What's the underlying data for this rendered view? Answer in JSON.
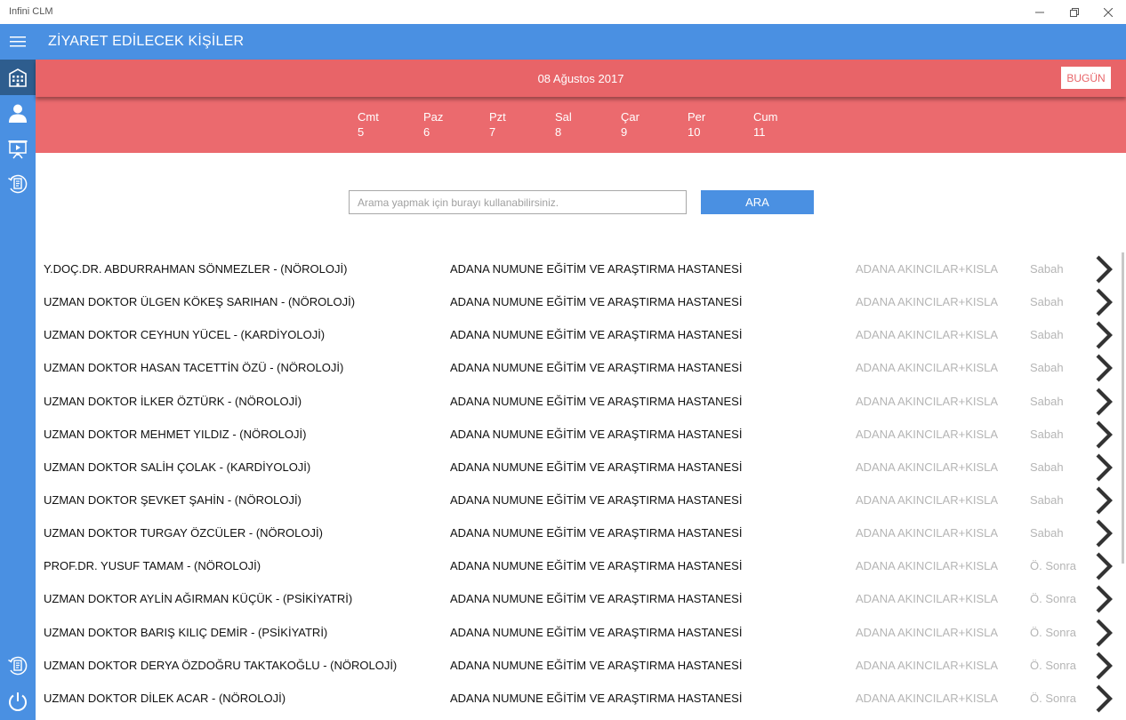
{
  "window": {
    "title": "Infini CLM"
  },
  "header": {
    "title": "ZİYARET EDİLECEK KİŞİLER"
  },
  "date_bar": {
    "current_date": "08 Ağustos 2017",
    "today_label": "BUGÜN",
    "days": [
      {
        "name": "Cmt",
        "num": "5"
      },
      {
        "name": "Paz",
        "num": "6"
      },
      {
        "name": "Pzt",
        "num": "7"
      },
      {
        "name": "Sal",
        "num": "8"
      },
      {
        "name": "Çar",
        "num": "9"
      },
      {
        "name": "Per",
        "num": "10"
      },
      {
        "name": "Cum",
        "num": "11"
      }
    ]
  },
  "search": {
    "placeholder": "Arama yapmak için burayı kullanabilirsiniz.",
    "value": "",
    "button_label": "ARA"
  },
  "icons": {
    "sidebar": [
      "menu-icon",
      "building-icon",
      "user-icon",
      "presentation-icon",
      "visits-icon",
      "reports-icon",
      "power-icon"
    ],
    "row": "chevron-right-icon"
  },
  "colors": {
    "accent": "#4a90e2",
    "sidebar_active": "#2e5d8e",
    "date_band": "#eb6a6e",
    "muted_text": "#b5b5b5"
  },
  "visits": [
    {
      "name": "Y.DOÇ.DR. ABDURRAHMAN SÖNMEZLER - (NÖROLOJİ)",
      "hospital": "ADANA NUMUNE EĞİTİM VE ARAŞTIRMA HASTANESİ",
      "area": "ADANA AKINCILAR+KISLA",
      "time": "Sabah"
    },
    {
      "name": "UZMAN DOKTOR ÜLGEN KÖKEŞ SARIHAN - (NÖROLOJİ)",
      "hospital": "ADANA NUMUNE EĞİTİM VE ARAŞTIRMA HASTANESİ",
      "area": "ADANA AKINCILAR+KISLA",
      "time": "Sabah"
    },
    {
      "name": "UZMAN DOKTOR CEYHUN YÜCEL - (KARDİYOLOJİ)",
      "hospital": "ADANA NUMUNE EĞİTİM VE ARAŞTIRMA HASTANESİ",
      "area": "ADANA AKINCILAR+KISLA",
      "time": "Sabah"
    },
    {
      "name": "UZMAN DOKTOR HASAN TACETTİN ÖZÜ - (NÖROLOJİ)",
      "hospital": "ADANA NUMUNE EĞİTİM VE ARAŞTIRMA HASTANESİ",
      "area": "ADANA AKINCILAR+KISLA",
      "time": "Sabah"
    },
    {
      "name": "UZMAN DOKTOR İLKER ÖZTÜRK - (NÖROLOJİ)",
      "hospital": "ADANA NUMUNE EĞİTİM VE ARAŞTIRMA HASTANESİ",
      "area": "ADANA AKINCILAR+KISLA",
      "time": "Sabah"
    },
    {
      "name": "UZMAN DOKTOR MEHMET YILDIZ - (NÖROLOJİ)",
      "hospital": "ADANA NUMUNE EĞİTİM VE ARAŞTIRMA HASTANESİ",
      "area": "ADANA AKINCILAR+KISLA",
      "time": "Sabah"
    },
    {
      "name": "UZMAN DOKTOR SALİH ÇOLAK - (KARDİYOLOJİ)",
      "hospital": "ADANA NUMUNE EĞİTİM VE ARAŞTIRMA HASTANESİ",
      "area": "ADANA AKINCILAR+KISLA",
      "time": "Sabah"
    },
    {
      "name": "UZMAN DOKTOR ŞEVKET ŞAHİN - (NÖROLOJİ)",
      "hospital": "ADANA NUMUNE EĞİTİM VE ARAŞTIRMA HASTANESİ",
      "area": "ADANA AKINCILAR+KISLA",
      "time": "Sabah"
    },
    {
      "name": "UZMAN DOKTOR TURGAY ÖZCÜLER - (NÖROLOJİ)",
      "hospital": "ADANA NUMUNE EĞİTİM VE ARAŞTIRMA HASTANESİ",
      "area": "ADANA AKINCILAR+KISLA",
      "time": "Sabah"
    },
    {
      "name": "PROF.DR. YUSUF TAMAM - (NÖROLOJİ)",
      "hospital": "ADANA NUMUNE EĞİTİM VE ARAŞTIRMA HASTANESİ",
      "area": "ADANA AKINCILAR+KISLA",
      "time": "Ö. Sonra"
    },
    {
      "name": "UZMAN DOKTOR AYLİN AĞIRMAN KÜÇÜK - (PSİKİYATRİ)",
      "hospital": "ADANA NUMUNE EĞİTİM VE ARAŞTIRMA HASTANESİ",
      "area": "ADANA AKINCILAR+KISLA",
      "time": "Ö. Sonra"
    },
    {
      "name": "UZMAN DOKTOR BARIŞ KILIÇ DEMİR - (PSİKİYATRİ)",
      "hospital": "ADANA NUMUNE EĞİTİM VE ARAŞTIRMA HASTANESİ",
      "area": "ADANA AKINCILAR+KISLA",
      "time": "Ö. Sonra"
    },
    {
      "name": "UZMAN DOKTOR DERYA ÖZDOĞRU TAKTAKOĞLU - (NÖROLOJİ)",
      "hospital": "ADANA NUMUNE EĞİTİM VE ARAŞTIRMA HASTANESİ",
      "area": "ADANA AKINCILAR+KISLA",
      "time": "Ö. Sonra"
    },
    {
      "name": "UZMAN DOKTOR DİLEK ACAR - (NÖROLOJİ)",
      "hospital": "ADANA NUMUNE EĞİTİM VE ARAŞTIRMA HASTANESİ",
      "area": "ADANA AKINCILAR+KISLA",
      "time": "Ö. Sonra"
    }
  ]
}
